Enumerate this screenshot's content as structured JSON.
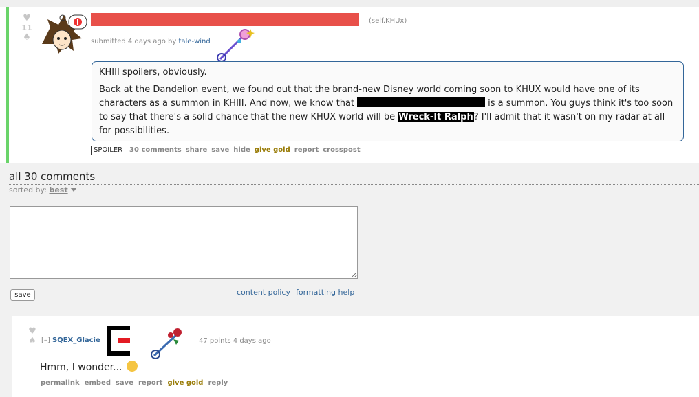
{
  "post": {
    "score": "11",
    "domain": "(self.KHUx)",
    "submitted_prefix": "submitted 4 days ago by",
    "author": "tale-wind",
    "selftext": {
      "p1": "KHIII spoilers, obviously.",
      "p2_a": "Back at the Dandelion event, we found out that the brand-new Disney world coming soon to KHUX would have one of its characters as a summon in KHIII. And now, we know that",
      "p2_b": "is a summon. You guys think it's too soon to say that there's a solid chance that the new KHUX world will be",
      "spoiler_text": "Wreck-It Ralph",
      "p2_c": "? I'll admit that it wasn't on my radar at all for possibilities."
    },
    "buttons": {
      "spoiler": "SPOILER",
      "comments": "30 comments",
      "share": "share",
      "save": "save",
      "hide": "hide",
      "give_gold": "give gold",
      "report": "report",
      "crosspost": "crosspost"
    },
    "colors": {
      "title_redacted": "#e8504a",
      "accent_bar": "#6ad46a"
    }
  },
  "comments_header": {
    "title": "all 30 comments",
    "sorted_label": "sorted by:",
    "sorted_value": "best"
  },
  "form": {
    "save": "save",
    "content_policy": "content policy",
    "formatting_help": "formatting help"
  },
  "comment": {
    "collapse": "[–]",
    "author": "SQEX_Glacie",
    "points": "47 points 4 days ago",
    "body": "Hmm, I wonder...",
    "buttons": {
      "permalink": "permalink",
      "embed": "embed",
      "save": "save",
      "report": "report",
      "give_gold": "give gold",
      "reply": "reply"
    }
  }
}
